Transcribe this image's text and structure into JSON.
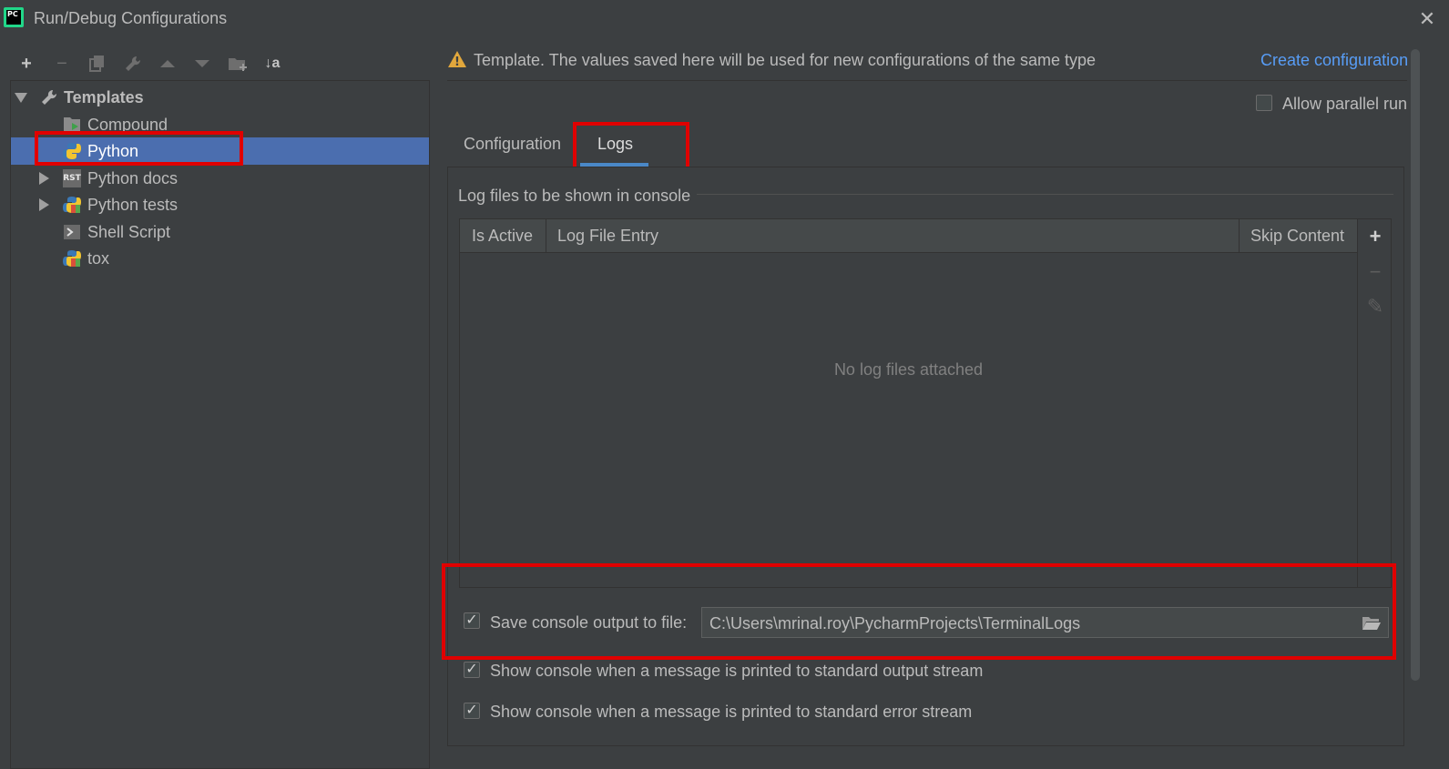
{
  "window": {
    "title": "Run/Debug Configurations",
    "logo_text": "PC"
  },
  "toolbar": {
    "buttons": [
      "add-icon",
      "remove-icon",
      "copy-icon",
      "wrench-icon",
      "move-up-icon",
      "move-down-icon",
      "new-folder-icon",
      "sort-alpha-icon"
    ],
    "sort_glyph": "↓a"
  },
  "tree": {
    "root": {
      "label": "Templates",
      "expanded": true
    },
    "items": [
      {
        "label": "Compound",
        "icon": "compound-icon",
        "expandable": false,
        "selected": false
      },
      {
        "label": "Python",
        "icon": "python-icon",
        "expandable": false,
        "selected": true
      },
      {
        "label": "Python docs",
        "icon": "rst-docs-icon",
        "icon_text": "RST",
        "expandable": true,
        "selected": false
      },
      {
        "label": "Python tests",
        "icon": "python-tests-icon",
        "expandable": true,
        "selected": false
      },
      {
        "label": "Shell Script",
        "icon": "shell-script-icon",
        "expandable": false,
        "selected": false
      },
      {
        "label": "tox",
        "icon": "tox-icon",
        "expandable": false,
        "selected": false
      }
    ]
  },
  "banner": {
    "text": "Template. The values saved here will be used for new configurations of the same type",
    "link": "Create configuration",
    "warning_glyph": "!"
  },
  "allow_parallel_run": {
    "label": "Allow parallel run",
    "checked": false
  },
  "tabs": [
    {
      "label": "Configuration",
      "active": false
    },
    {
      "label": "Logs",
      "active": true
    }
  ],
  "logs": {
    "section_title": "Log files to be shown in console",
    "columns": [
      "Is Active",
      "Log File Entry",
      "Skip Content"
    ],
    "empty_text": "No log files attached",
    "side_buttons": {
      "add": "+",
      "remove": "−",
      "edit": "✎"
    },
    "save_console": {
      "label": "Save console output to file:",
      "checked": true,
      "path": "C:\\Users\\mrinal.roy\\PycharmProjects\\TerminalLogs"
    },
    "show_stdout": {
      "label": "Show console when a message is printed to standard output stream",
      "checked": true
    },
    "show_stderr": {
      "label": "Show console when a message is printed to standard error stream",
      "checked": true
    }
  },
  "colors": {
    "background": "#3c3f41",
    "selection": "#4b6eaf",
    "link": "#589df6",
    "highlight": "#e00000",
    "tab_underline": "#4a88c7"
  }
}
